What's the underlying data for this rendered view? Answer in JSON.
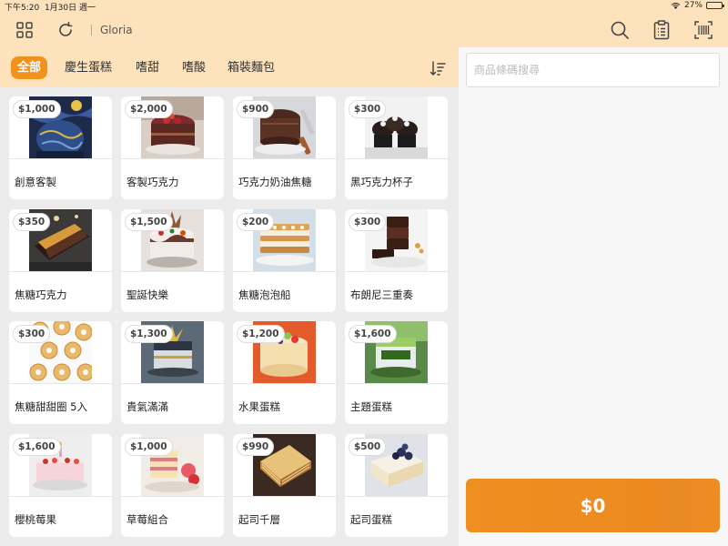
{
  "status_bar": {
    "time": "下午5:20",
    "date": "1月30日 週一",
    "battery": "27%",
    "battery_fraction": 0.27
  },
  "header": {
    "user_name": "Gloria"
  },
  "categories": [
    {
      "label": "全部",
      "active": true
    },
    {
      "label": "慶生蛋糕",
      "active": false
    },
    {
      "label": "嗜甜",
      "active": false
    },
    {
      "label": "嗜酸",
      "active": false
    },
    {
      "label": "箱裝麵包",
      "active": false
    }
  ],
  "products": [
    {
      "name": "創意客製",
      "price": "$1,000"
    },
    {
      "name": "客製巧克力",
      "price": "$2,000"
    },
    {
      "name": "巧克力奶油焦糖",
      "price": "$900"
    },
    {
      "name": "黑巧克力杯子",
      "price": "$300"
    },
    {
      "name": "焦糖巧克力",
      "price": "$350"
    },
    {
      "name": "聖誕快樂",
      "price": "$1,500"
    },
    {
      "name": "焦糖泡泡船",
      "price": "$200"
    },
    {
      "name": "布朗尼三重奏",
      "price": "$300"
    },
    {
      "name": "焦糖甜甜圈 5入",
      "price": "$300"
    },
    {
      "name": "貴氣滿滿",
      "price": "$1,300"
    },
    {
      "name": "水果蛋糕",
      "price": "$1,200"
    },
    {
      "name": "主題蛋糕",
      "price": "$1,600"
    },
    {
      "name": "櫻桃莓果",
      "price": "$1,600"
    },
    {
      "name": "草莓組合",
      "price": "$1,000"
    },
    {
      "name": "起司千層",
      "price": "$990"
    },
    {
      "name": "起司蛋糕",
      "price": "$500"
    }
  ],
  "search": {
    "placeholder": "商品條碼搜尋"
  },
  "cart": {
    "total": "$0"
  },
  "colors": {
    "accent": "#f0921c",
    "header_bg": "#fde2bc"
  }
}
